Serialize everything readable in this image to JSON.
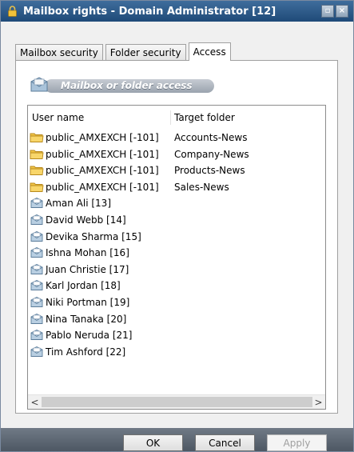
{
  "window": {
    "title": "Mailbox rights - Domain Administrator [12]",
    "icon": "lock-icon"
  },
  "titlebar_buttons": [
    {
      "name": "restore",
      "glyph": "▫"
    },
    {
      "name": "close",
      "glyph": "×"
    }
  ],
  "tabs": [
    {
      "label": "Mailbox security",
      "active": false
    },
    {
      "label": "Folder security",
      "active": false
    },
    {
      "label": "Access",
      "active": true
    }
  ],
  "section": {
    "title": "Mailbox or folder access",
    "icon": "mailbox-icon"
  },
  "table": {
    "columns": [
      "User name",
      "Target folder"
    ],
    "rows": [
      {
        "name": "public_AMXEXCH [-101]",
        "folder": "Accounts-News",
        "icon": "folder-icon"
      },
      {
        "name": "public_AMXEXCH [-101]",
        "folder": "Company-News",
        "icon": "folder-icon"
      },
      {
        "name": "public_AMXEXCH [-101]",
        "folder": "Products-News",
        "icon": "folder-icon"
      },
      {
        "name": "public_AMXEXCH [-101]",
        "folder": "Sales-News",
        "icon": "folder-icon"
      },
      {
        "name": "Aman Ali [13]",
        "folder": "",
        "icon": "mailbox-icon"
      },
      {
        "name": "David Webb [14]",
        "folder": "",
        "icon": "mailbox-icon"
      },
      {
        "name": "Devika Sharma [15]",
        "folder": "",
        "icon": "mailbox-icon"
      },
      {
        "name": "Ishna Mohan [16]",
        "folder": "",
        "icon": "mailbox-icon"
      },
      {
        "name": "Juan Christie [17]",
        "folder": "",
        "icon": "mailbox-icon"
      },
      {
        "name": "Karl Jordan [18]",
        "folder": "",
        "icon": "mailbox-icon"
      },
      {
        "name": "Niki Portman [19]",
        "folder": "",
        "icon": "mailbox-icon"
      },
      {
        "name": "Nina Tanaka [20]",
        "folder": "",
        "icon": "mailbox-icon"
      },
      {
        "name": "Pablo Neruda [21]",
        "folder": "",
        "icon": "mailbox-icon"
      },
      {
        "name": "Tim Ashford [22]",
        "folder": "",
        "icon": "mailbox-icon"
      }
    ]
  },
  "scrollbar": {
    "left_glyph": "<",
    "right_glyph": ">"
  },
  "buttons": {
    "ok": "OK",
    "cancel": "Cancel",
    "apply": "Apply"
  },
  "colors": {
    "titlebar": "#2b5785",
    "folder": "#f0c040",
    "mailbox": "#7fa6c9",
    "footer": "#5e6874"
  }
}
